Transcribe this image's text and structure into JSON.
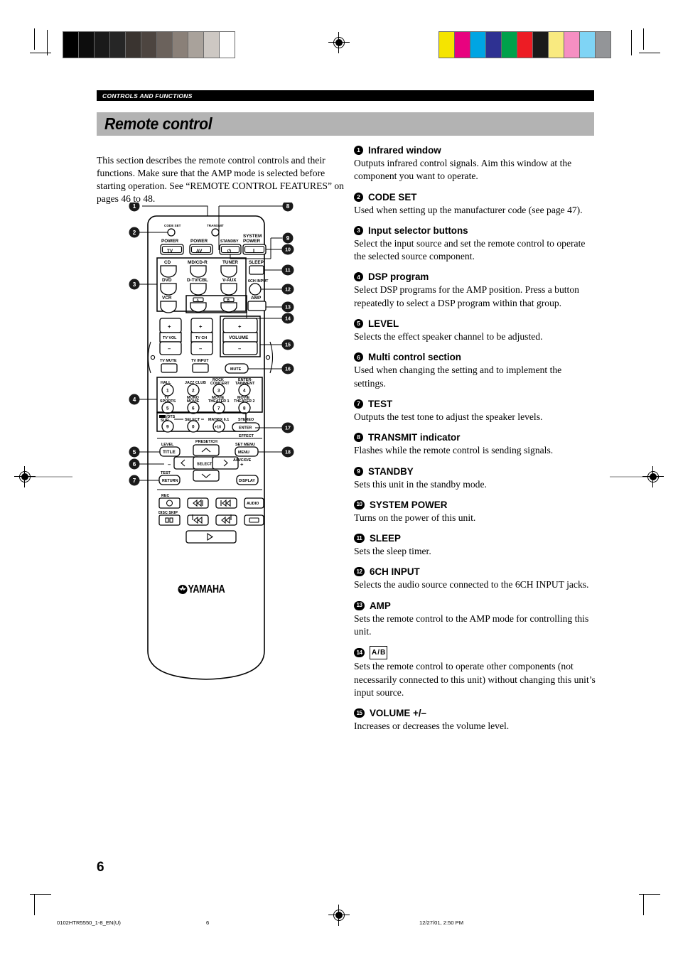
{
  "header": {
    "section_tab": "CONTROLS AND FUNCTIONS",
    "title": "Remote control"
  },
  "intro": "This section describes the remote control controls and their functions. Make sure that the AMP mode is selected before starting operation. See “REMOTE CONTROL FEATURES” on pages 46 to 48.",
  "entries": [
    {
      "num": "1",
      "title": "Infrared window",
      "body": "Outputs infrared control signals. Aim this window at the component you want to operate."
    },
    {
      "num": "2",
      "title": "CODE SET",
      "body": "Used when setting up the manufacturer code (see page 47)."
    },
    {
      "num": "3",
      "title": "Input selector buttons",
      "body": "Select the input source and set the remote control to operate the selected source component."
    },
    {
      "num": "4",
      "title": "DSP program",
      "body": "Select DSP programs for the AMP position. Press a button repeatedly to select a DSP program within that group."
    },
    {
      "num": "5",
      "title": "LEVEL",
      "body": "Selects the effect speaker channel to be adjusted."
    },
    {
      "num": "6",
      "title": "Multi control section",
      "body": "Used when changing the setting and to implement the settings."
    },
    {
      "num": "7",
      "title": "TEST",
      "body": "Outputs the test tone to adjust the speaker levels."
    },
    {
      "num": "8",
      "title": "TRANSMIT indicator",
      "body": "Flashes while the remote control is sending signals."
    },
    {
      "num": "9",
      "title": "STANDBY",
      "body": "Sets this unit in the standby mode."
    },
    {
      "num": "10",
      "title": "SYSTEM POWER",
      "body": "Turns on the power of this unit."
    },
    {
      "num": "11",
      "title": "SLEEP",
      "body": "Sets the sleep timer."
    },
    {
      "num": "12",
      "title": "6CH INPUT",
      "body": "Selects the audio source connected to the 6CH INPUT jacks."
    },
    {
      "num": "13",
      "title": "AMP",
      "body": "Sets the remote control to the AMP mode for controlling this unit."
    },
    {
      "num": "14",
      "title": "",
      "title_boxed": [
        "A",
        "B"
      ],
      "body": "Sets the remote control to operate other components (not necessarily connected to this unit) without changing this unit’s input source."
    },
    {
      "num": "15",
      "title": "VOLUME +/–",
      "body": "Increases or decreases the volume level."
    }
  ],
  "page_number": "6",
  "footer": {
    "file": "0102HTR5550_1-8_EN(U)",
    "page": "6",
    "timestamp": "12/27/01, 2:50 PM"
  },
  "color_bars": {
    "grayscale": [
      "#000000",
      "#0d0d0d",
      "#1a1a1a",
      "#262626",
      "#3a3430",
      "#4d4540",
      "#6b625c",
      "#8a8078",
      "#a9a29b",
      "#cdc8c3",
      "#ffffff"
    ],
    "colors": [
      "#f5e400",
      "#e8027f",
      "#00a5e3",
      "#2e3192",
      "#00a14b",
      "#ed1c24",
      "#1a1a1a",
      "#f9ea80",
      "#f58fc2",
      "#7fd4f5",
      "#939598"
    ]
  },
  "remote": {
    "labels": {
      "code_set": "CODE SET",
      "transmit": "TRANSMIT",
      "power_tv_top": "POWER",
      "power_tv": "TV",
      "power_av_top": "POWER",
      "power_av": "AV",
      "standby": "STANDBY",
      "system_power": "SYSTEM POWER",
      "sleep": "SLEEP",
      "six_ch_input": "6CH INPUT",
      "amp": "AMP",
      "cd": "CD",
      "md_cdr": "MD/CD-R",
      "tuner": "TUNER",
      "dvd": "DVD",
      "dtv_cbl": "D-TV/CBL",
      "v_aux": "V-AUX",
      "vcr": "VCR",
      "ab_a": "A",
      "ab_b": "B",
      "tv_vol": "TV VOL",
      "tv_ch": "TV CH",
      "volume": "VOLUME",
      "plus": "+",
      "minus": "–",
      "tv_mute": "TV MUTE",
      "tv_input": "TV INPUT",
      "mute": "MUTE",
      "hall": "HALL",
      "jazz_club": "JAZZ CLUB",
      "rock_concert": "ROCK CONCERT",
      "entertainment": "ENTER- TAINMENT",
      "tv_sports": "TV SPORTS",
      "mono_movie": "MONO MOVIE",
      "movie_theater_1": "MOVIE THEATER 1",
      "movie_theater_2": "MOVIE THEATER 2",
      "dts_sur": "/DTS SUR.",
      "select_small": "SELECT",
      "matrix": "MATRIX 6.1",
      "stereo": "STEREO",
      "enter": "ENTER",
      "effect": "EFFECT",
      "level": "LEVEL",
      "title": "TITLE",
      "preset_ch": "PRESET/CH",
      "set_menu": "SET MENU",
      "menu": "MENU",
      "abcde": "A/B/C/D/E",
      "select": "SELECT",
      "test": "TEST",
      "return": "RETURN",
      "display": "DISPLAY",
      "rec": "REC",
      "disc_skip": "DISC SKIP",
      "audio": "AUDIO",
      "brand": "YAMAHA",
      "keys": [
        "1",
        "2",
        "3",
        "4",
        "5",
        "6",
        "7",
        "8",
        "9",
        "0",
        "+10"
      ]
    },
    "callouts": [
      "1",
      "2",
      "3",
      "4",
      "5",
      "6",
      "7",
      "8",
      "9",
      "10",
      "11",
      "12",
      "13",
      "14",
      "15",
      "16",
      "17",
      "18"
    ]
  }
}
